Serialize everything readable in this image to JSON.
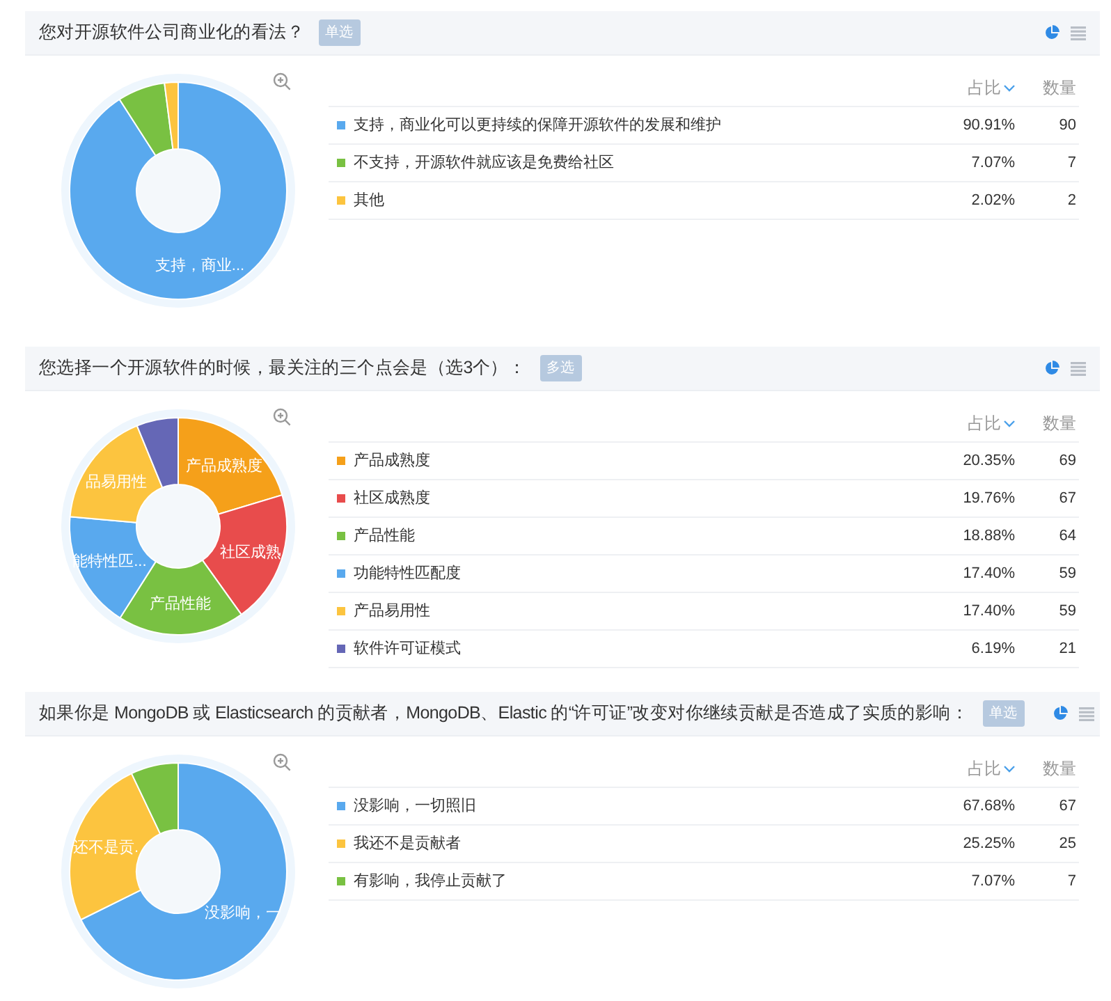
{
  "questions": [
    {
      "title": "您对开源软件公司商业化的看法？",
      "tag": "单选",
      "share_header": "占比",
      "count_header": "数量",
      "rows": [
        {
          "label": "支持，商业化可以更持续的保障开源软件的发展和维护",
          "share": "90.91%",
          "count": "90",
          "color": "#59a9ee",
          "slice_label": "支持，商业..."
        },
        {
          "label": "不支持，开源软件就应该是免费给社区",
          "share": "7.07%",
          "count": "7",
          "color": "#79c142"
        },
        {
          "label": "其他",
          "share": "2.02%",
          "count": "2",
          "color": "#fcc43f"
        }
      ]
    },
    {
      "title": "您选择一个开源软件的时候，最关注的三个点会是（选3个）：",
      "tag": "多选",
      "share_header": "占比",
      "count_header": "数量",
      "rows": [
        {
          "label": "产品成熟度",
          "share": "20.35%",
          "count": "69",
          "color": "#f5a01a",
          "slice_label": "产品成熟度"
        },
        {
          "label": "社区成熟度",
          "share": "19.76%",
          "count": "67",
          "color": "#e84c4c",
          "slice_label": "社区成熟"
        },
        {
          "label": "产品性能",
          "share": "18.88%",
          "count": "64",
          "color": "#79c142",
          "slice_label": "产品性能"
        },
        {
          "label": "功能特性匹配度",
          "share": "17.40%",
          "count": "59",
          "color": "#59a9ee",
          "slice_label": "能特性匹..."
        },
        {
          "label": "产品易用性",
          "share": "17.40%",
          "count": "59",
          "color": "#fcc43f",
          "slice_label": "品易用性"
        },
        {
          "label": "软件许可证模式",
          "share": "6.19%",
          "count": "21",
          "color": "#6567b6"
        }
      ]
    },
    {
      "title": "如果你是 MongoDB 或 Elasticsearch 的贡献者，MongoDB、Elastic 的“许可证”改变对你继续贡献是否造成了实质的影响：",
      "tag": "单选",
      "share_header": "占比",
      "count_header": "数量",
      "rows": [
        {
          "label": "没影响，一切照旧",
          "share": "67.68%",
          "count": "67",
          "color": "#59a9ee",
          "slice_label": "没影响，一"
        },
        {
          "label": "我还不是贡献者",
          "share": "25.25%",
          "count": "25",
          "color": "#fcc43f",
          "slice_label": "还不是贡."
        },
        {
          "label": "有影响，我停止贡献了",
          "share": "7.07%",
          "count": "7",
          "color": "#79c142"
        }
      ]
    }
  ]
}
